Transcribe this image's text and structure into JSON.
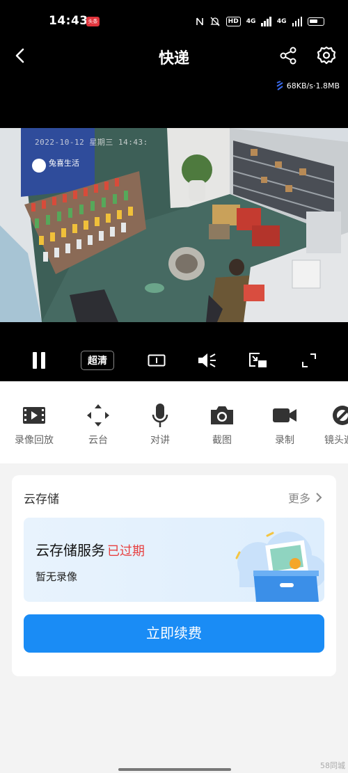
{
  "status_bar": {
    "time": "14:43",
    "app_badge": "头条",
    "network": "4G",
    "network2": "4G"
  },
  "nav": {
    "title": "快递",
    "back_icon": "back-arrow-icon",
    "share_icon": "share-icon",
    "settings_icon": "gear-icon"
  },
  "stream": {
    "speed": "68KB/s·1.8MB",
    "osd_text": "2022-10-12 星期三 14:43:"
  },
  "controls": {
    "quality_label": "超清",
    "icons": [
      "pause-icon",
      "aspect-ratio-icon",
      "mute-icon",
      "picture-in-picture-icon",
      "fullscreen-icon"
    ]
  },
  "tools": [
    {
      "label": "录像回放",
      "icon": "playback-film-icon"
    },
    {
      "label": "云台",
      "icon": "ptz-direction-icon"
    },
    {
      "label": "对讲",
      "icon": "microphone-icon"
    },
    {
      "label": "截图",
      "icon": "camera-icon"
    },
    {
      "label": "录制",
      "icon": "video-record-icon"
    },
    {
      "label": "镜头遮",
      "icon": "lens-cover-icon"
    }
  ],
  "cloud_storage": {
    "title": "云存储",
    "more_label": "更多",
    "service_label": "云存储服务",
    "status_label": "已过期",
    "sub_label": "暂无录像",
    "renew_button": "立即续费"
  },
  "watermark": "58同城",
  "colors": {
    "accent": "#1a8cf5",
    "expired": "#e74040"
  }
}
